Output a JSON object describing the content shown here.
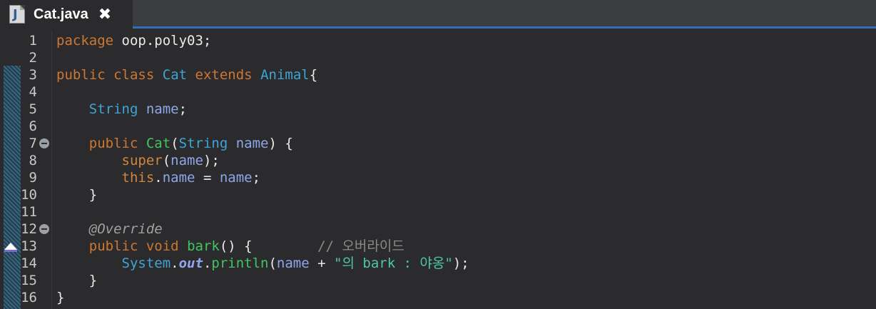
{
  "tab": {
    "title": "Cat.java",
    "icon_letter": "J",
    "close_glyph": "✖"
  },
  "colors": {
    "keyword": "#cc7832",
    "type": "#3ea5d6",
    "field": "#8fa7ea",
    "method": "#42c463",
    "annotation": "#a0a0a0",
    "comment": "#8a8a8a",
    "string": "#4fc8a0",
    "tab_underline": "#2f6fb5"
  },
  "gutter": {
    "line_numbers": [
      "1",
      "2",
      "3",
      "4",
      "5",
      "6",
      "7",
      "8",
      "9",
      "10",
      "11",
      "12",
      "13",
      "14",
      "15",
      "16"
    ],
    "fold_markers_on_lines": [
      7,
      12
    ],
    "override_marker_on_line": 13
  },
  "code": {
    "l1": {
      "kw_package": "package",
      "pkg": " oop.poly03;"
    },
    "l3": {
      "kw_public": "public",
      "kw_class": "class",
      "cls": "Cat",
      "kw_extends": "extends",
      "parent": "Animal",
      "brace": "{"
    },
    "l5": {
      "type": "String",
      "field": "name",
      "semi": ";"
    },
    "l7": {
      "kw_public": "public",
      "ctor": "Cat",
      "open": "(",
      "ptype": "String",
      "pname": "name",
      "close": ") {"
    },
    "l8": {
      "kw_super": "super",
      "open": "(",
      "arg": "name",
      "close": ");"
    },
    "l9": {
      "kw_this": "this",
      "dot": ".",
      "field": "name",
      "eq": " = ",
      "val": "name",
      "semi": ";"
    },
    "l10": {
      "brace": "}"
    },
    "l12": {
      "annotation": "@Override"
    },
    "l13": {
      "kw_public": "public",
      "kw_void": "void",
      "method": "bark",
      "rest": "() {",
      "comment": "// 오버라이드"
    },
    "l14": {
      "sys": "System",
      "dot1": ".",
      "out": "out",
      "dot2": ".",
      "println": "println",
      "open": "(",
      "arg": "name",
      "plus": " + ",
      "str": "\"의 bark : 야옹\"",
      "close": ");"
    },
    "l15": {
      "brace": "}"
    },
    "l16": {
      "brace": "}"
    }
  }
}
